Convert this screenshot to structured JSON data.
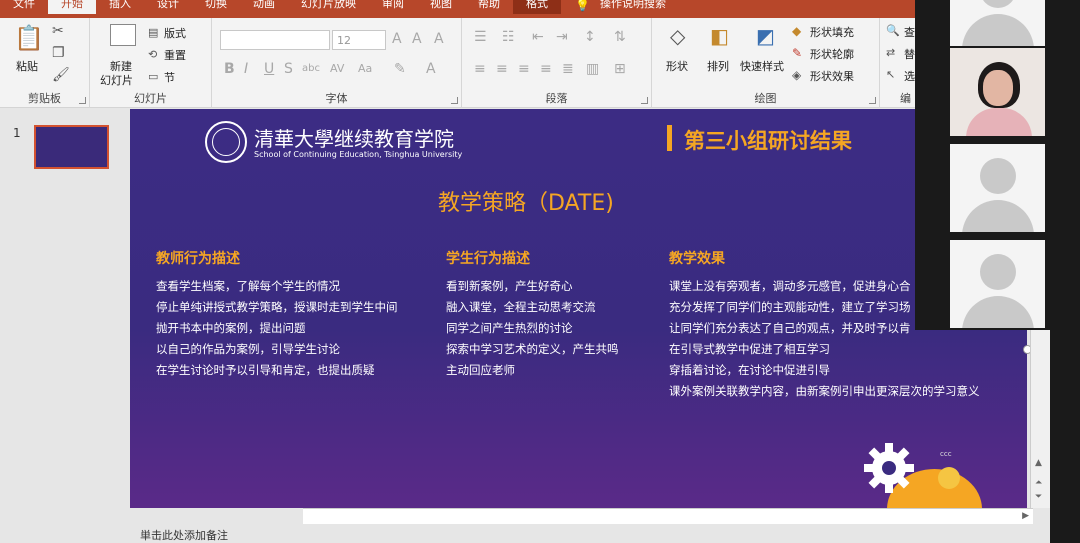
{
  "tabs": [
    "文件",
    "开始",
    "插入",
    "设计",
    "切换",
    "动画",
    "幻灯片放映",
    "审阅",
    "视图",
    "帮助",
    "格式"
  ],
  "tell_me": "操作说明搜索",
  "ribbon": {
    "clipboard": {
      "paste": "粘贴",
      "label": "剪贴板"
    },
    "slides": {
      "new_slide_line1": "新建",
      "new_slide_line2": "幻灯片",
      "layout": "版式",
      "reset": "重置",
      "section": "节",
      "label": "幻灯片"
    },
    "font": {
      "size": "12",
      "label": "字体"
    },
    "paragraph": {
      "label": "段落"
    },
    "drawing": {
      "shapes": "形状",
      "arrange": "排列",
      "quick_styles": "快速样式",
      "fill": "形状填充",
      "outline": "形状轮廓",
      "effect": "形状效果",
      "label": "绘图"
    },
    "editing": {
      "find": "查",
      "replace": "替",
      "select": "选",
      "label": "编"
    }
  },
  "slide_number": "1",
  "slide": {
    "logo_main": "清華大學继续教育学院",
    "logo_sub": "School of Continuing Education, Tsinghua University",
    "group_title": "第三小组研讨结果",
    "main_title": "教学策略（DATE)",
    "columns": [
      {
        "heading": "教师行为描述",
        "lines": [
          "查看学生档案，了解每个学生的情况",
          "停止单纯讲授式教学策略，授课时走到学生中间",
          "抛开书本中的案例，提出问题",
          "以自己的作品为案例，引导学生讨论",
          "在学生讨论时予以引导和肯定，也提出质疑"
        ]
      },
      {
        "heading": "学生行为描述",
        "lines": [
          "看到新案例，产生好奇心",
          "融入课堂，全程主动思考交流",
          "同学之间产生热烈的讨论",
          "探索中学习艺术的定义，产生共鸣",
          "主动回应老师"
        ]
      },
      {
        "heading": "教学效果",
        "lines": [
          "课堂上没有旁观者，调动多元感官，促进身心合",
          "充分发挥了同学们的主观能动性，建立了学习场",
          "让同学们充分表达了自己的观点，并及时予以肯",
          "在引导式教学中促进了相互学习",
          "穿插着讨论，在讨论中促进引导",
          "课外案例关联教学内容，由新案例引申出更深层次的学习意义"
        ]
      }
    ],
    "ccc": "ccc"
  },
  "notes_text": "単击此处添加备注"
}
